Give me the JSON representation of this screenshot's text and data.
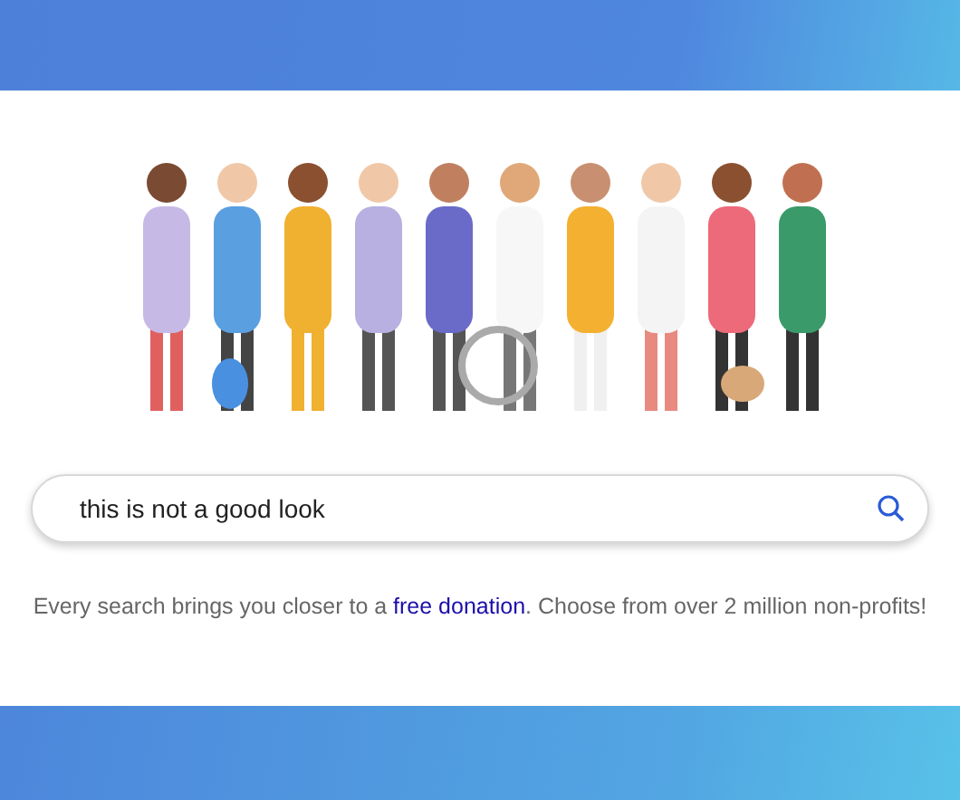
{
  "search": {
    "value": "this is not a good look"
  },
  "tagline": {
    "before": "Every search brings you closer to a ",
    "link": "free donation",
    "after": ". Choose from over 2 million non-profits!"
  }
}
